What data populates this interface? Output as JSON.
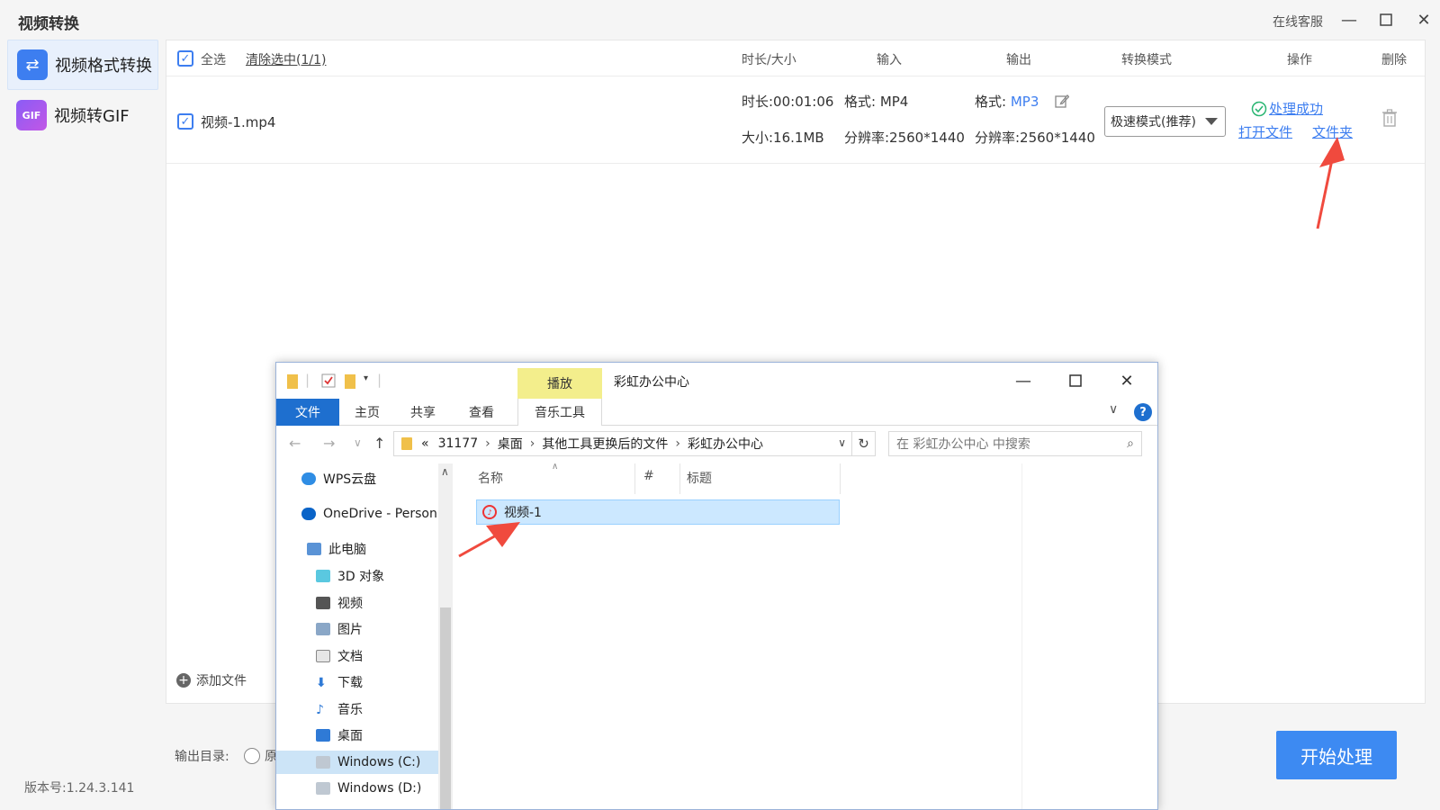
{
  "app": {
    "title": "视频转换",
    "online_service": "在线客服",
    "version": "版本号:1.24.3.141"
  },
  "sidebar": {
    "items": [
      {
        "label": "视频格式转换",
        "icon": "convert-icon",
        "active": true
      },
      {
        "label": "视频转GIF",
        "icon": "gif-icon",
        "icon_text": "GIF",
        "active": false
      }
    ]
  },
  "list_header": {
    "select_all": "全选",
    "clear_selected": "清除选中(1/1)",
    "col_duration_size": "时长/大小",
    "col_input": "输入",
    "col_output": "输出",
    "col_mode": "转换模式",
    "col_action": "操作",
    "col_delete": "删除"
  },
  "file_row": {
    "name": "视频-1.mp4",
    "duration": "时长:00:01:06",
    "size": "大小:16.1MB",
    "input_format": "格式: MP4",
    "input_resolution": "分辨率:2560*1440",
    "output_format_label": "格式: ",
    "output_format_value": "MP3",
    "output_resolution": "分辨率:2560*1440",
    "mode": "极速模式(推荐)",
    "status": "处理成功",
    "open_file": "打开文件",
    "open_folder": "文件夹"
  },
  "footer": {
    "add_file": "添加文件",
    "output_dir_label": "输出目录:",
    "output_dir_option": "原",
    "start_button": "开始处理"
  },
  "explorer": {
    "title": "彩虹办公中心",
    "play_tab": "播放",
    "tabs": [
      "文件",
      "主页",
      "共享",
      "查看",
      "音乐工具"
    ],
    "address": [
      "«",
      "31177",
      "桌面",
      "其他工具更换后的文件",
      "彩虹办公中心"
    ],
    "search_placeholder": "在 彩虹办公中心 中搜索",
    "columns": [
      "名称",
      "#",
      "标题"
    ],
    "files": [
      {
        "name": "视频-1"
      }
    ],
    "nav_tree": [
      {
        "label": "WPS云盘",
        "icon": "cloud-icon"
      },
      {
        "label": "OneDrive - Person",
        "icon": "onedrive-icon"
      },
      {
        "label": "此电脑",
        "icon": "computer-icon"
      },
      {
        "label": "3D 对象",
        "icon": "cube-icon"
      },
      {
        "label": "视频",
        "icon": "film-icon"
      },
      {
        "label": "图片",
        "icon": "picture-icon"
      },
      {
        "label": "文档",
        "icon": "document-icon"
      },
      {
        "label": "下载",
        "icon": "download-icon"
      },
      {
        "label": "音乐",
        "icon": "music-note-icon"
      },
      {
        "label": "桌面",
        "icon": "desktop-icon"
      },
      {
        "label": "Windows (C:)",
        "icon": "drive-icon",
        "selected": true
      },
      {
        "label": "Windows (D:)",
        "icon": "drive-icon"
      }
    ]
  },
  "colors": {
    "accent": "#3d7ef0",
    "start_button": "#3d8af2",
    "success": "#2bb673",
    "annotation_arrow": "#f04a3e"
  }
}
